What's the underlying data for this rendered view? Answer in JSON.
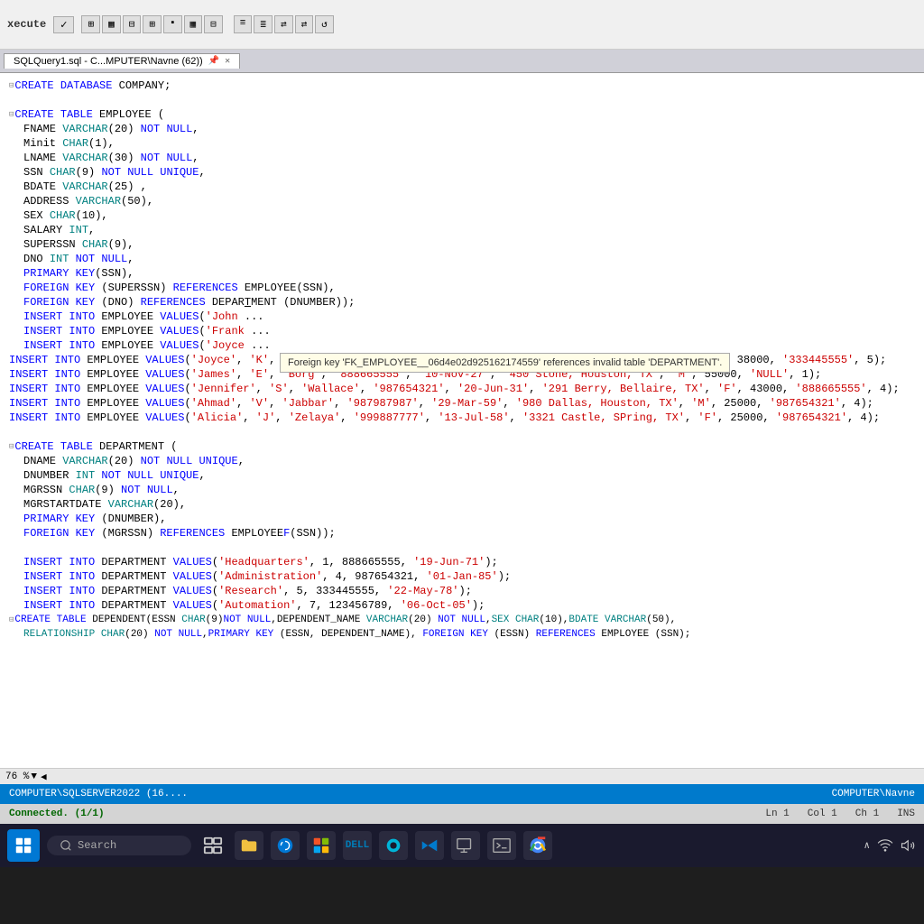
{
  "toolbar": {
    "execute_label": "xecute",
    "check_label": "✓"
  },
  "tab": {
    "title": "SQLQuery1.sql - C...MPUTER\\Navne (62))",
    "pin_icon": "📌",
    "close_icon": "✕"
  },
  "editor": {
    "lines": [
      "CREATE DATABASE COMPANY;",
      "",
      "CREATE TABLE EMPLOYEE (",
      "  FNAME VARCHAR(20) NOT NULL,",
      "  Minit CHAR(1),",
      "  LNAME VARCHAR(30) NOT NULL,",
      "  SSN CHAR(9) NOT NULL UNIQUE,",
      "  BDATE VARCHAR(25) ,",
      "  ADDRESS VARCHAR(50),",
      "  SEX CHAR(10),",
      "  SALARY INT,",
      "  SUPERSSN CHAR(9),",
      "  DNO INT NOT NULL,",
      "  PRIMARY KEY(SSN),",
      "  FOREIGN KEY (SUPERSSN) REFERENCES EMPLOYEE(SSN),",
      "  FOREIGN KEY (DNO) REFERENCES DEPARTMENT (DNUMBER));",
      "  INSERT INTO EMPLOYEE VALUES('John ...",
      "  INSERT INTO EMPLOYEE VALUES('Frank ...",
      "  INSERT INTO EMPLOYEE VALUES('Joyce ...",
      "INSERT INTO EMPLOYEE VALUES('Joyce', 'K', 'Narayan', '666884444', '15-Sep-52', '975 Fire Oak, Humble, TX', 'M', 38000, '333445555', 5);",
      "INSERT INTO EMPLOYEE VALUES('James', 'E', 'Borg', '888665555', '10-Nov-27', '450 Stone, Houston, TX', 'M', 55000, 'NULL', 1);",
      "INSERT INTO EMPLOYEE VALUES('Jennifer', 'S', 'Wallace', '987654321', '20-Jun-31', '291 Berry, Bellaire, TX', 'F', 43000, '888665555', 4);",
      "INSERT INTO EMPLOYEE VALUES('Ahmad', 'V', 'Jabbar', '987987987', '29-Mar-59', '980 Dallas, Houston, TX', 'M', 25000, '987654321', 4);",
      "INSERT INTO EMPLOYEE VALUES('Alicia', 'J', 'Zelaya', '999887777', '13-Jul-58', '3321 Castle, SPring, TX', 'F', 25000, '987654321', 4);"
    ],
    "dept_lines": [
      "CREATE TABLE DEPARTMENT (",
      "  DNAME VARCHAR(20) NOT NULL UNIQUE,",
      "  DNUMBER INT NOT NULL UNIQUE,",
      "  MGRSSN CHAR(9) NOT NULL,",
      "  MGRSTARTDATE VARCHAR(20),",
      "  PRIMARY KEY (DNUMBER),",
      "  FOREIGN KEY (MGRSSN) REFERENCES EMPLOYEE(SSN));"
    ],
    "dept_inserts": [
      "INSERT INTO DEPARTMENT VALUES('Headquarters', 1, 888665555, '19-Jun-71');",
      "INSERT INTO DEPARTMENT VALUES('Administration', 4, 987654321, '01-Jan-85');",
      "INSERT INTO DEPARTMENT VALUES('Research', 5, 333445555, '22-May-78');",
      "INSERT INTO DEPARTMENT VALUES('Automation', 7, 123456789, '06-Oct-05');"
    ],
    "dependent_line": "CREATE TABLE DEPENDENT(ESSN CHAR(9)NOT NULL,DEPENDENT_NAME VARCHAR(20) NOT NULL,SEX CHAR(10),BDATE VARCHAR(50),",
    "dependent_line2": "  RELATIONSHIP CHAR(20) NOT NULL,PRIMARY KEY (ESSN, DEPENDENT_NAME), FOREIGN KEY (ESSN) REFERENCES EMPLOYEE (SSN);"
  },
  "tooltip": {
    "text": "Foreign key 'FK_EMPLOYEE__06d4e02d925162174559' references invalid table 'DEPARTMENT'."
  },
  "zoom_bar": {
    "zoom": "76 %"
  },
  "status_bar": {
    "server": "COMPUTER\\SQLSERVER2022 (16....",
    "user": "COMPUTER\\Navne"
  },
  "bottom_status": {
    "connected": "Connected. (1/1)",
    "ln": "Ln 1",
    "col": "Col 1",
    "ch": "Ch 1",
    "ins": "INS"
  },
  "taskbar": {
    "search_placeholder": "Search"
  }
}
